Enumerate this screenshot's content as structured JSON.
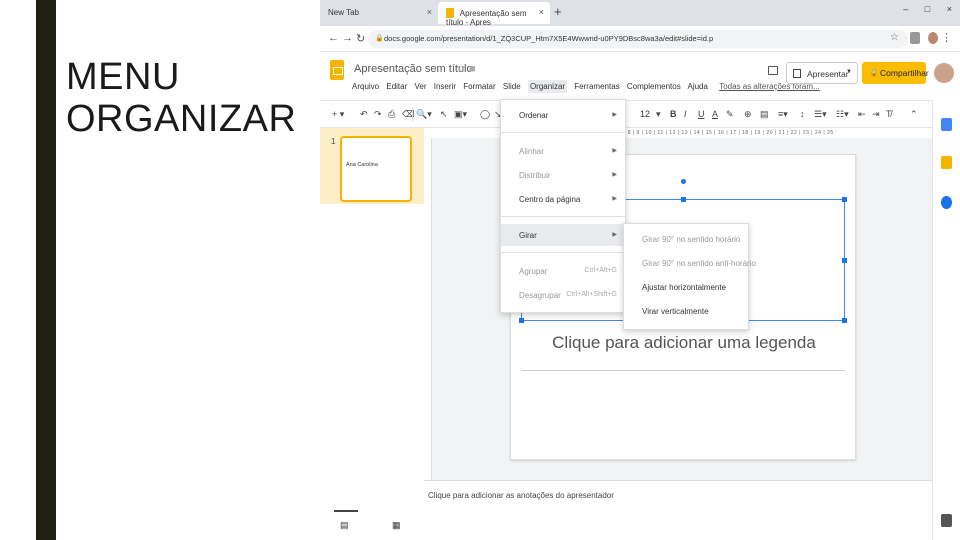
{
  "caption": {
    "line1": "MENU",
    "line2": "ORGANIZAR"
  },
  "browser": {
    "tabs": [
      {
        "label": "New Tab",
        "close": "×"
      },
      {
        "label": "Apresentação sem título - Apres",
        "close": "×"
      }
    ],
    "new_tab": "+",
    "window_controls": "–  □  ×",
    "url": "docs.google.com/presentation/d/1_ZQ3CUP_Htm7X5E4Wwwnd-u0PY9DBsc8wa3a/edit#slide=id.p"
  },
  "docs": {
    "title": "Apresentação sem título",
    "menu": [
      "Arquivo",
      "Editar",
      "Ver",
      "Inserir",
      "Formatar",
      "Slide",
      "Organizar",
      "Ferramentas",
      "Complementos",
      "Ajuda"
    ],
    "all_changes": "Todas as alterações foram...",
    "present_label": "Apresentar",
    "share_label": "Compartilhar"
  },
  "toolbar": {
    "font_size": "12"
  },
  "filmstrip": {
    "slide_number": "1",
    "thumb_text": "Ana Carolina"
  },
  "ruler": {
    "ticks": "| 8 | 9 | 10 | 11 | 12 | 13 | 14 | 15 | 16 | 17 | 18 | 19 | 20 | 21 | 22 | 23 | 24 | 25"
  },
  "slide": {
    "subtitle_placeholder": "Clique para adicionar uma legenda"
  },
  "organize_menu": {
    "items": [
      {
        "label": "Ordenar",
        "arrow": "▶"
      },
      {
        "label": "Alinhar",
        "arrow": "▶"
      },
      {
        "label": "Distribuir",
        "arrow": "▶"
      },
      {
        "label": "Centro da página",
        "arrow": "▶"
      },
      {
        "label": "Girar",
        "arrow": "▶"
      },
      {
        "label": "Agrupar",
        "shortcut": "Ctrl+Alt+G"
      },
      {
        "label": "Desagrupar",
        "shortcut": "Ctrl+Alt+Shift+G"
      }
    ]
  },
  "rotate_submenu": {
    "items": [
      {
        "label": "Girar 90° no sentido horário"
      },
      {
        "label": "Girar 90° no sentido anti-horário"
      },
      {
        "label": "Ajustar horizontalmente"
      },
      {
        "label": "Virar verticalmente"
      }
    ]
  },
  "notes": {
    "placeholder": "Clique para adicionar as anotações do apresentador"
  },
  "colors": {
    "accent": "#f4b400",
    "selection": "#4285f4",
    "share_button": "#fbbc04"
  }
}
